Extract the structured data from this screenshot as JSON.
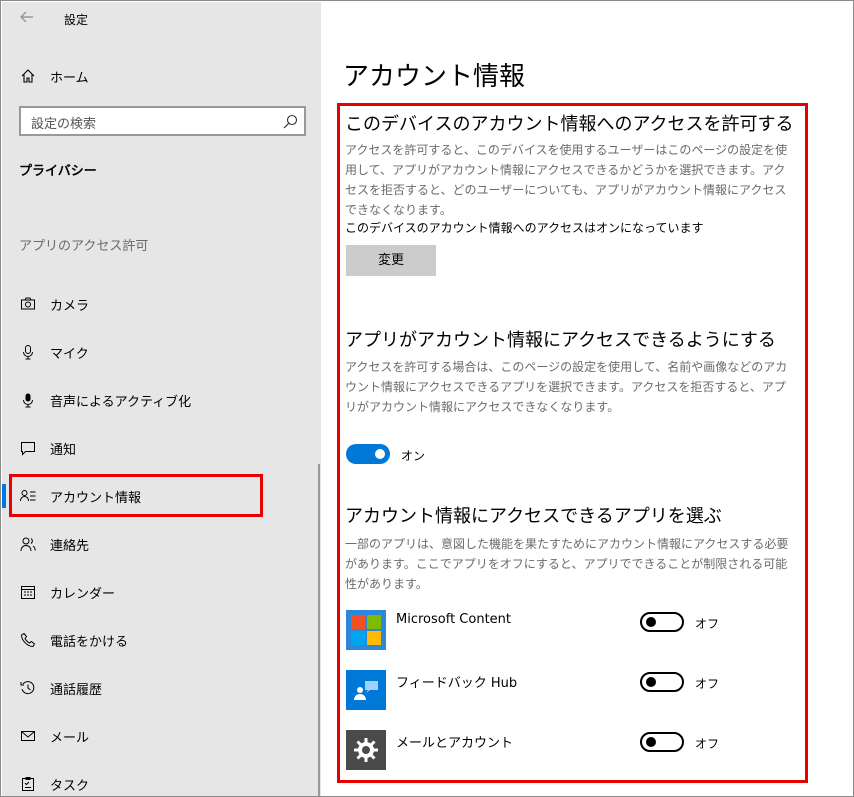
{
  "window": {
    "title": "設定"
  },
  "sidebar": {
    "home_label": "ホーム",
    "search_placeholder": "設定の検索",
    "section_title": "プライバシー",
    "group_title": "アプリのアクセス許可",
    "items": [
      {
        "label": "カメラ",
        "icon": "camera-icon"
      },
      {
        "label": "マイク",
        "icon": "microphone-icon"
      },
      {
        "label": "音声によるアクティブ化",
        "icon": "voice-activation-icon"
      },
      {
        "label": "通知",
        "icon": "notification-icon"
      },
      {
        "label": "アカウント情報",
        "icon": "account-info-icon",
        "selected": true
      },
      {
        "label": "連絡先",
        "icon": "contacts-icon"
      },
      {
        "label": "カレンダー",
        "icon": "calendar-icon"
      },
      {
        "label": "電話をかける",
        "icon": "phone-icon"
      },
      {
        "label": "通話履歴",
        "icon": "call-history-icon"
      },
      {
        "label": "メール",
        "icon": "mail-icon"
      },
      {
        "label": "タスク",
        "icon": "tasks-icon"
      }
    ]
  },
  "main": {
    "page_title": "アカウント情報",
    "device_section": {
      "heading": "このデバイスのアカウント情報へのアクセスを許可する",
      "description": "アクセスを許可すると、このデバイスを使用するユーザーはこのページの設定を使用して、アプリがアカウント情報にアクセスできるかどうかを選択できます。アクセスを拒否すると、どのユーザーについても、アプリがアカウント情報にアクセスできなくなります。",
      "status": "このデバイスのアカウント情報へのアクセスはオンになっています",
      "change_label": "変更"
    },
    "app_section": {
      "heading": "アプリがアカウント情報にアクセスできるようにする",
      "description": "アクセスを許可する場合は、このページの設定を使用して、名前や画像などのアカウント情報にアクセスできるアプリを選択できます。アクセスを拒否すると、アプリがアカウント情報にアクセスできなくなります。",
      "toggle_state": "オン"
    },
    "choose_section": {
      "heading": "アカウント情報にアクセスできるアプリを選ぶ",
      "description": "一部のアプリは、意図した機能を果たすためにアカウント情報にアクセスする必要があります。ここでアプリをオフにすると、アプリでできることが制限される可能性があります。",
      "apps": [
        {
          "name": "Microsoft Content",
          "state": "オフ",
          "icon": "microsoft-logo-icon"
        },
        {
          "name": "フィードバック Hub",
          "state": "オフ",
          "icon": "feedback-hub-icon"
        },
        {
          "name": "メールとアカウント",
          "state": "オフ",
          "icon": "gear-icon"
        }
      ]
    }
  },
  "colors": {
    "accent": "#0078d7",
    "highlight_border": "#e60000",
    "sidebar_bg": "#e6e6e6"
  }
}
